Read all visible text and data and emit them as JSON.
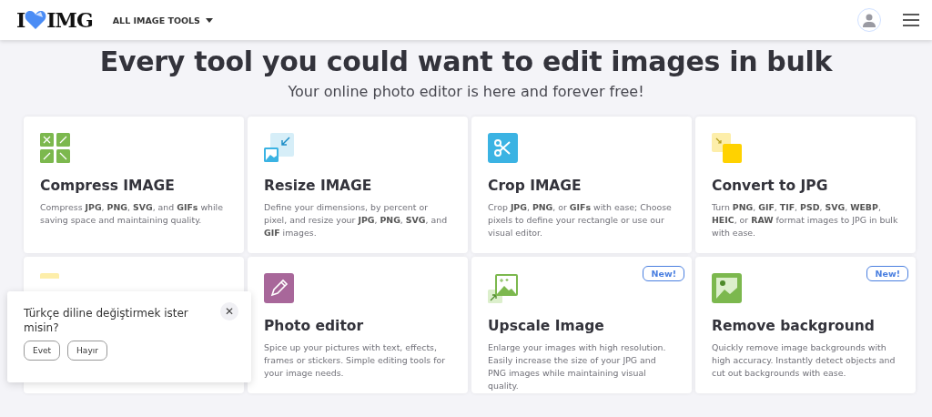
{
  "header": {
    "logo_left": "I",
    "logo_right": "IMG",
    "menu": "ALL IMAGE TOOLS"
  },
  "hero": {
    "title": "Every tool you could want to edit images in bulk",
    "subtitle": "Your online photo editor is here and forever free!"
  },
  "tools": [
    {
      "kind": "compress",
      "title": "Compress IMAGE",
      "description": "Compress **JPG**, **PNG**, **SVG**, and **GIFs** while saving space and maintaining quality.",
      "is_new": false
    },
    {
      "kind": "resize",
      "title": "Resize IMAGE",
      "description": "Define your dimensions, by percent or pixel, and resize your **JPG**, **PNG**, **SVG**, and **GIF** images.",
      "is_new": false
    },
    {
      "kind": "crop",
      "title": "Crop IMAGE",
      "description": "Crop **JPG**, **PNG**, or **GIFs** with ease; Choose pixels to define your rectangle or use our visual editor.",
      "is_new": false
    },
    {
      "kind": "tojpg",
      "title": "Convert to JPG",
      "description": "Turn **PNG**, **GIF**, **TIF**, **PSD**, **SVG**, **WEBP**, **HEIC**, or **RAW** format images to JPG in bulk with ease.",
      "is_new": false
    },
    {
      "kind": "fromjpg",
      "is_new": false
    },
    {
      "kind": "editor",
      "title": "Photo editor",
      "description": "Spice up your pictures with text, effects, frames or stickers. Simple editing tools for your image needs.",
      "is_new": false
    },
    {
      "kind": "upscale",
      "title": "Upscale Image",
      "description": "Enlarge your images with high resolution. Easily increase the size of your JPG and PNG images while maintaining visual quality.",
      "is_new": true,
      "badge": "New!"
    },
    {
      "kind": "removebg",
      "title": "Remove background",
      "description": "Quickly remove image backgrounds with high accuracy. Instantly detect objects and cut out backgrounds with ease.",
      "is_new": true,
      "badge": "New!"
    }
  ],
  "language_popup": {
    "question": "Türkçe diline değiştirmek ister misin?",
    "buttons": [
      "Evet",
      "Hayır"
    ],
    "close": "✕"
  }
}
